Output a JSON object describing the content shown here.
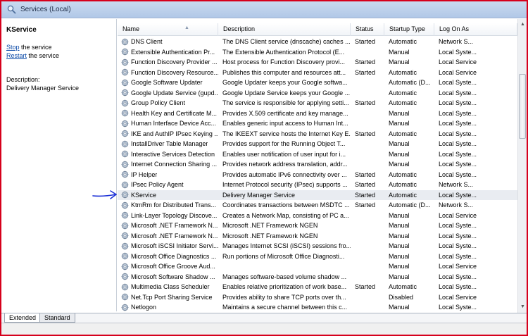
{
  "window": {
    "title": "Services (Local)"
  },
  "left_pane": {
    "service_name": "KService",
    "actions": [
      {
        "link": "Stop",
        "rest": " the service"
      },
      {
        "link": "Restart",
        "rest": " the service"
      }
    ],
    "description_label": "Description:",
    "description_value": "Delivery Manager Service"
  },
  "columns": [
    "Name",
    "Description",
    "Status",
    "Startup Type",
    "Log On As"
  ],
  "rows": [
    {
      "name": "DNS Client",
      "description": "The DNS Client service (dnscache) caches ...",
      "status": "Started",
      "startup": "Automatic",
      "logon": "Network S..."
    },
    {
      "name": "Extensible Authentication Pr...",
      "description": "The Extensible Authentication Protocol (E...",
      "status": "",
      "startup": "Manual",
      "logon": "Local Syste..."
    },
    {
      "name": "Function Discovery Provider ...",
      "description": "Host process for Function Discovery provi...",
      "status": "Started",
      "startup": "Manual",
      "logon": "Local Service"
    },
    {
      "name": "Function Discovery Resource...",
      "description": "Publishes this computer and resources att...",
      "status": "Started",
      "startup": "Automatic",
      "logon": "Local Service"
    },
    {
      "name": "Google Software Updater",
      "description": "Google Updater keeps your Google softwa...",
      "status": "",
      "startup": "Automatic (D...",
      "logon": "Local Syste..."
    },
    {
      "name": "Google Update Service (gupd...",
      "description": "Google Update Service keeps your Google ...",
      "status": "",
      "startup": "Automatic",
      "logon": "Local Syste..."
    },
    {
      "name": "Group Policy Client",
      "description": "The service is responsible for applying setti...",
      "status": "Started",
      "startup": "Automatic",
      "logon": "Local Syste..."
    },
    {
      "name": "Health Key and Certificate M...",
      "description": "Provides X.509 certificate and key manage...",
      "status": "",
      "startup": "Manual",
      "logon": "Local Syste..."
    },
    {
      "name": "Human Interface Device Acc...",
      "description": "Enables generic input access to Human Int...",
      "status": "",
      "startup": "Manual",
      "logon": "Local Syste..."
    },
    {
      "name": "IKE and AuthIP IPsec Keying ...",
      "description": "The IKEEXT service hosts the Internet Key E...",
      "status": "Started",
      "startup": "Automatic",
      "logon": "Local Syste..."
    },
    {
      "name": "InstallDriver Table Manager",
      "description": "Provides support for the Running Object T...",
      "status": "",
      "startup": "Manual",
      "logon": "Local Syste..."
    },
    {
      "name": "Interactive Services Detection",
      "description": "Enables user notification of user input for i...",
      "status": "",
      "startup": "Manual",
      "logon": "Local Syste..."
    },
    {
      "name": "Internet Connection Sharing ...",
      "description": "Provides network address translation, addr...",
      "status": "",
      "startup": "Manual",
      "logon": "Local Syste..."
    },
    {
      "name": "IP Helper",
      "description": "Provides automatic IPv6 connectivity over ...",
      "status": "Started",
      "startup": "Automatic",
      "logon": "Local Syste..."
    },
    {
      "name": "IPsec Policy Agent",
      "description": "Internet Protocol security (IPsec) supports ...",
      "status": "Started",
      "startup": "Automatic",
      "logon": "Network S..."
    },
    {
      "name": "KService",
      "description": "Delivery Manager Service",
      "status": "Started",
      "startup": "Automatic",
      "logon": "Local Syste...",
      "selected": true
    },
    {
      "name": "KtmRm for Distributed Trans...",
      "description": "Coordinates transactions between MSDTC ...",
      "status": "Started",
      "startup": "Automatic (D...",
      "logon": "Network S..."
    },
    {
      "name": "Link-Layer Topology Discove...",
      "description": "Creates a Network Map, consisting of PC a...",
      "status": "",
      "startup": "Manual",
      "logon": "Local Service"
    },
    {
      "name": "Microsoft .NET Framework N...",
      "description": "Microsoft .NET Framework NGEN",
      "status": "",
      "startup": "Manual",
      "logon": "Local Syste..."
    },
    {
      "name": "Microsoft .NET Framework N...",
      "description": "Microsoft .NET Framework NGEN",
      "status": "",
      "startup": "Manual",
      "logon": "Local Syste..."
    },
    {
      "name": "Microsoft iSCSI Initiator Servi...",
      "description": "Manages Internet SCSI (iSCSI) sessions fro...",
      "status": "",
      "startup": "Manual",
      "logon": "Local Syste..."
    },
    {
      "name": "Microsoft Office Diagnostics ...",
      "description": "Run portions of Microsoft Office Diagnosti...",
      "status": "",
      "startup": "Manual",
      "logon": "Local Syste..."
    },
    {
      "name": "Microsoft Office Groove Aud...",
      "description": "",
      "status": "",
      "startup": "Manual",
      "logon": "Local Service"
    },
    {
      "name": "Microsoft Software Shadow ...",
      "description": "Manages software-based volume shadow ...",
      "status": "",
      "startup": "Manual",
      "logon": "Local Syste..."
    },
    {
      "name": "Multimedia Class Scheduler",
      "description": "Enables relative prioritization of work base...",
      "status": "Started",
      "startup": "Automatic",
      "logon": "Local Syste..."
    },
    {
      "name": "Net.Tcp Port Sharing Service",
      "description": "Provides ability to share TCP ports over th...",
      "status": "",
      "startup": "Disabled",
      "logon": "Local Service"
    },
    {
      "name": "Netlogon",
      "description": "Maintains a secure channel between this c...",
      "status": "",
      "startup": "Manual",
      "logon": "Local Syste..."
    }
  ],
  "tabs": [
    "Extended",
    "Standard"
  ],
  "icons": {
    "service": "gear-icon",
    "title": "magnifier-icon",
    "annotation": "arrow-icon"
  },
  "colors": {
    "frame_border": "#d6001c",
    "annotation_arrow": "#1a2fd6",
    "link": "#0b4aa8"
  }
}
